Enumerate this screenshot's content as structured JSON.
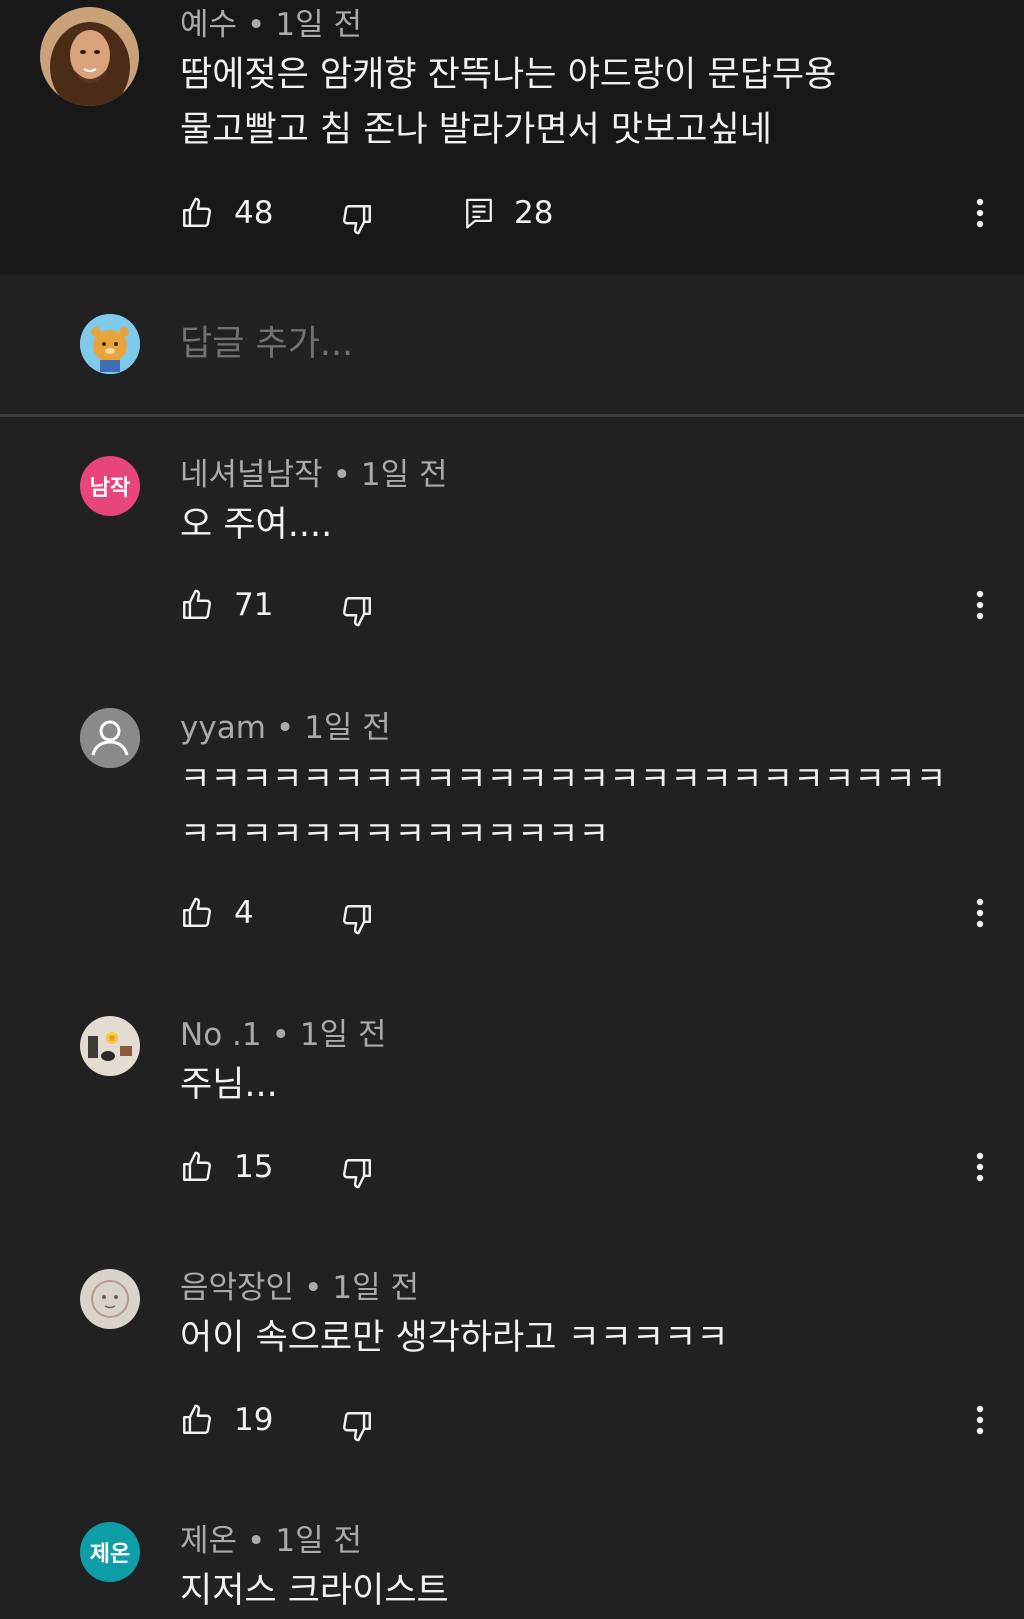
{
  "top_comment": {
    "author": "예수",
    "time": "1일 전",
    "lines": [
      "땀에젖은 암캐향 잔뜩나는 야드랑이 문답무용",
      "물고빨고 침 존나 발라가면서 맛보고싶네"
    ],
    "likes": "48",
    "replies": "28"
  },
  "reply_box": {
    "placeholder": "답글 추가..."
  },
  "separator": "•",
  "comments": [
    {
      "author": "네셔널남작",
      "time": "1일 전",
      "avatar_text": "남작",
      "avatar_color": "#e8457a",
      "lines": [
        "오 주여...."
      ],
      "likes": "71"
    },
    {
      "author": "yyam",
      "time": "1일 전",
      "lines": [
        "ㅋㅋㅋㅋㅋㅋㅋㅋㅋㅋㅋㅋㅋㅋㅋㅋㅋㅋㅋㅋㅋㅋㅋㅋㅋ",
        "ㅋㅋㅋㅋㅋㅋㅋㅋㅋㅋㅋㅋㅋㅋ"
      ],
      "likes": "4"
    },
    {
      "author": "No .1",
      "time": "1일 전",
      "lines": [
        "주님..."
      ],
      "likes": "15"
    },
    {
      "author": "음악장인",
      "time": "1일 전",
      "lines": [
        "어이 속으로만 생각하라고 ㅋㅋㅋㅋㅋ"
      ],
      "likes": "19"
    },
    {
      "author": "제온",
      "time": "1일 전",
      "avatar_text": "제온",
      "avatar_color": "#0f9ea7",
      "lines": [
        "지저스 크라이스트"
      ]
    }
  ]
}
